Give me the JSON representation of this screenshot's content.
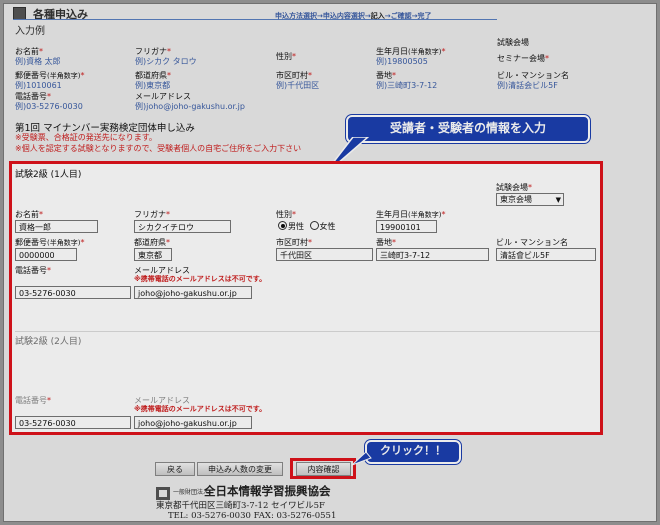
{
  "header": {
    "title": "各種申込み",
    "steps": [
      "申込方法選択",
      "申込内容選択",
      "記入",
      "ご確認",
      "完了"
    ],
    "separator": "→"
  },
  "example": {
    "heading": "入力例",
    "exam_site_label": "試験会場",
    "seminar_site_label": "セミナー会場",
    "name_label": "お名前",
    "name_value": "例)資格 太郎",
    "furigana_label": "フリガナ",
    "furigana_value": "例)シカク タロウ",
    "gender_label": "性別",
    "birth_label": "生年月日",
    "birth_note": "(半角数字)",
    "birth_value": "例)19800505",
    "zip_label": "郵便番号",
    "zip_note": "(半角数字)",
    "zip_value": "例)1010061",
    "pref_label": "都道府県",
    "pref_value": "例)東京都",
    "city_label": "市区町村",
    "city_value": "例)千代田区",
    "addr_label": "番地",
    "addr_value": "例)三崎町3-7-12",
    "building_label": "ビル・マンション名",
    "building_value": "例)清話会ビル5F",
    "tel_label": "電話番号",
    "tel_value": "例)03-5276-0030",
    "mail_label": "メールアドレス",
    "mail_value": "例)joho@joho-gakushu.or.jp"
  },
  "org": {
    "title": "第1回 マイナンバー実務検定団体申し込み",
    "note1": "※受験票、合格証の発送先になります。",
    "note2": "※個人を認定する試験となりますので、受験者個人の自宅ご住所をご入力下さい"
  },
  "callout_top": "受講者・受験者の情報を入力",
  "callout_bottom": "クリック！！",
  "form": {
    "section1_title": "試験2級 (1人目)",
    "section2_title": "試験2級 (2人目)",
    "exam_site_label": "試験会場",
    "exam_site_value": "東京会場",
    "name_label": "お名前",
    "name_value": "資格一郎",
    "furigana_label": "フリガナ",
    "furigana_value": "シカクイチロウ",
    "gender_label": "性別",
    "gender_male": "男性",
    "gender_female": "女性",
    "birth_label": "生年月日",
    "birth_note": "(半角数字)",
    "birth_value": "19900101",
    "zip_label": "郵便番号",
    "zip_note": "(半角数字)",
    "zip_value": "0000000",
    "pref_label": "都道府県",
    "pref_value": "東京都",
    "city_label": "市区町村",
    "city_value": "千代田区",
    "addr_label": "番地",
    "addr_value": "三崎町3-7-12",
    "building_label": "ビル・マンション名",
    "building_value": "清話會ビル5F",
    "tel_label": "電話番号",
    "tel_value": "03-5276-0030",
    "mail_label": "メールアドレス",
    "mail_warning": "※携帯電話のメールアドレスは不可です。",
    "mail_value": "joho@joho-gakushu.or.jp",
    "tel2_value": "03-5276-0030",
    "mail2_value": "joho@joho-gakushu.or.jp",
    "required_mark": "*"
  },
  "buttons": {
    "back": "戻る",
    "change_count": "申込み人数の変更",
    "confirm": "内容確認"
  },
  "footer": {
    "org_prefix": "一般財団法人",
    "org_name": "全日本情報学習振興協会",
    "address": "東京都千代田区三崎町3-7-12 セイワビル5F",
    "contact": "TEL: 03-5276-0030  FAX: 03-5276-0551"
  },
  "colors": {
    "highlight": "#e0131c",
    "callout": "#1c3fb0",
    "link": "#3b5ea8"
  }
}
